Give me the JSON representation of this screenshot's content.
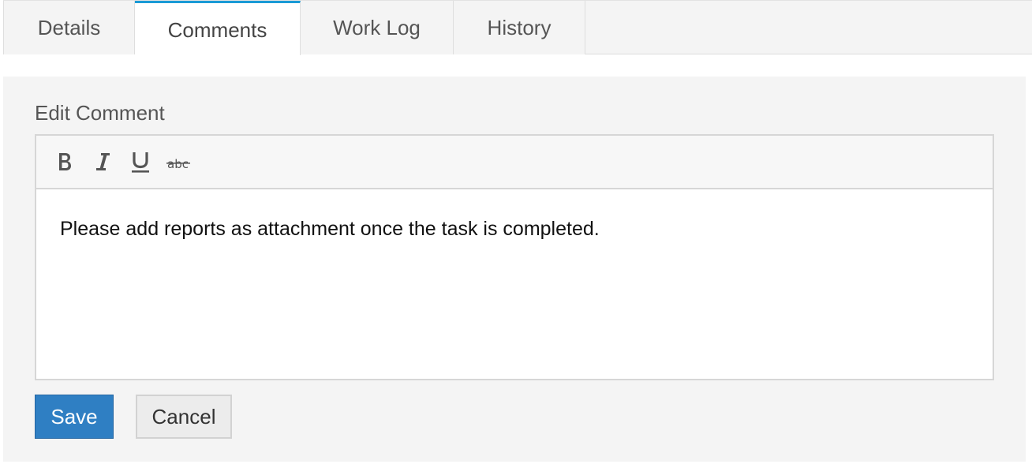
{
  "tabs": [
    {
      "label": "Details",
      "active": false
    },
    {
      "label": "Comments",
      "active": true
    },
    {
      "label": "Work Log",
      "active": false
    },
    {
      "label": "History",
      "active": false
    }
  ],
  "panel": {
    "title": "Edit Comment"
  },
  "toolbar": {
    "buttons": [
      {
        "name": "bold",
        "icon": "bold-icon"
      },
      {
        "name": "italic",
        "icon": "italic-icon"
      },
      {
        "name": "underline",
        "icon": "underline-icon"
      },
      {
        "name": "strikethrough",
        "icon": "strikethrough-icon"
      }
    ]
  },
  "editor": {
    "content": "Please add reports as attachment once the task is completed."
  },
  "actions": {
    "save_label": "Save",
    "cancel_label": "Cancel"
  },
  "colors": {
    "active_tab_accent": "#1a9ad6",
    "primary_button": "#2f7fc3",
    "panel_background": "#f4f4f4"
  }
}
